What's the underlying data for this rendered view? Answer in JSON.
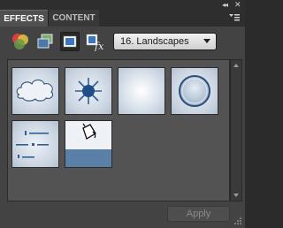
{
  "panel": {
    "tabs": [
      {
        "label": "EFFECTS",
        "active": true
      },
      {
        "label": "CONTENT",
        "active": false
      }
    ],
    "menu_icon": "panel-menu-icon"
  },
  "toolbar": {
    "tools": [
      {
        "name": "filters-tool",
        "icon": "filters-icon",
        "selected": false
      },
      {
        "name": "layer-styles-tool",
        "icon": "layer-styles-icon",
        "selected": false
      },
      {
        "name": "photo-effects-tool",
        "icon": "photo-effects-icon",
        "selected": true
      },
      {
        "name": "all-effects-tool",
        "icon": "fx-icon",
        "selected": false
      }
    ],
    "category": "16. Landscapes"
  },
  "thumbnails": [
    {
      "name": "effect-cloud",
      "icon": "cloud-icon"
    },
    {
      "name": "effect-sun",
      "icon": "sun-icon"
    },
    {
      "name": "effect-glow",
      "icon": "glow-icon"
    },
    {
      "name": "effect-bevel-circle",
      "icon": "bevel-circle-icon"
    },
    {
      "name": "effect-horizon-lines",
      "icon": "horizon-lines-icon"
    },
    {
      "name": "effect-fill-bucket",
      "icon": "paint-bucket-icon"
    }
  ],
  "footer": {
    "apply_label": "Apply",
    "apply_enabled": false
  },
  "colors": {
    "panel_bg": "#434343",
    "content_bg": "#535353",
    "thumb_light": "#eef2f7",
    "thumb_blue": "#5a80a8"
  }
}
